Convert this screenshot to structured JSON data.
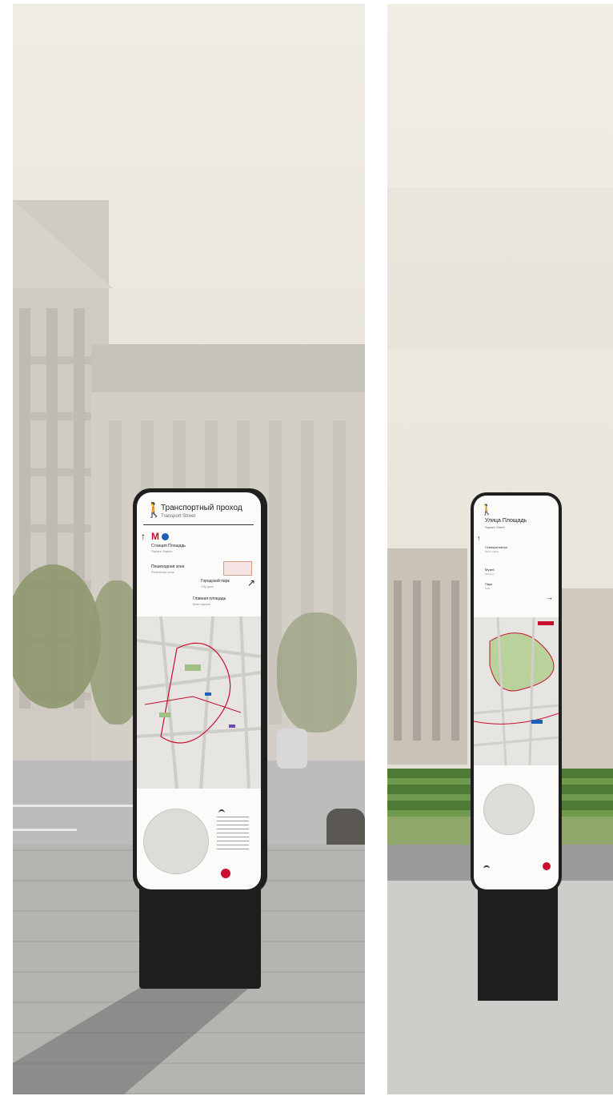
{
  "left_sign": {
    "title": "Транспортный проход",
    "subtitle": "Transport Street",
    "metro_letter": "М",
    "entries": [
      {
        "label": "Станция Площадь",
        "sub": "Square Station"
      },
      {
        "label": "Пешеходная зона",
        "sub": "Pedestrian zone"
      },
      {
        "label": "Городской парк",
        "sub": "City park"
      },
      {
        "label": "Главная площадь",
        "sub": "Main square"
      }
    ]
  },
  "right_sign": {
    "title": "Улица Площадь",
    "subtitle": "Square Street",
    "entries": [
      {
        "label": "Станция метро",
        "sub": "Metro station"
      },
      {
        "label": "Музей",
        "sub": "Museum"
      },
      {
        "label": "Парк",
        "sub": "Park"
      }
    ]
  },
  "colors": {
    "accent_red": "#c8102e",
    "metro_blue": "#1d5fb8",
    "pillar_dark": "#2a2a2a"
  }
}
